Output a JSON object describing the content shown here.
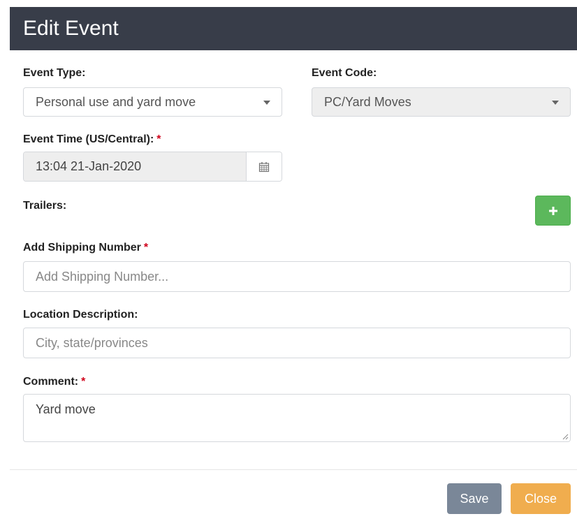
{
  "modal": {
    "title": "Edit Event"
  },
  "form": {
    "event_type": {
      "label": "Event Type:",
      "value": "Personal use and yard move"
    },
    "event_code": {
      "label": "Event Code:",
      "value": "PC/Yard Moves"
    },
    "event_time": {
      "label": "Event Time (US/Central):",
      "required_mark": "*",
      "value": "13:04 21-Jan-2020"
    },
    "trailers": {
      "label": "Trailers:",
      "add_button": "+"
    },
    "shipping_number": {
      "label": "Add Shipping Number",
      "required_mark": "*",
      "placeholder": "Add Shipping Number..."
    },
    "location_description": {
      "label": "Location Description:",
      "placeholder": "City, state/provinces"
    },
    "comment": {
      "label": "Comment:",
      "required_mark": "*",
      "value": "Yard move"
    }
  },
  "footer": {
    "save_label": "Save",
    "close_label": "Close"
  },
  "colors": {
    "header_bg": "#383d49",
    "success": "#5cb85c",
    "save_button": "#7a8798",
    "close_button": "#f0ad4e",
    "required": "#d0021b"
  },
  "icons": {
    "dropdown": "chevron-down-icon",
    "calendar": "calendar-icon",
    "add": "plus-icon",
    "resize": "resize-handle-icon"
  }
}
